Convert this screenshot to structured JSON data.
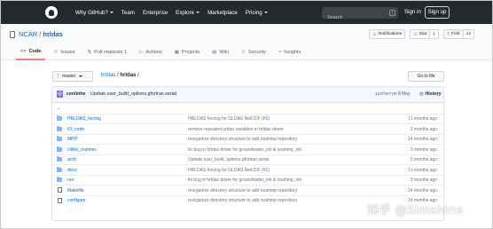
{
  "topnav": {
    "links": [
      {
        "label": "Why GitHub?",
        "dropdown": true
      },
      {
        "label": "Team",
        "dropdown": false
      },
      {
        "label": "Enterprise",
        "dropdown": false
      },
      {
        "label": "Explore",
        "dropdown": true
      },
      {
        "label": "Marketplace",
        "dropdown": false
      },
      {
        "label": "Pricing",
        "dropdown": true
      }
    ],
    "search_placeholder": "Search",
    "search_shortcut": "/",
    "signin": "Sign in",
    "signup": "Sign up"
  },
  "repo": {
    "owner": "NCAR",
    "separator": "/",
    "name": "hrldas",
    "actions": [
      {
        "icon": "bell-icon",
        "label": "Notifications",
        "count": ""
      },
      {
        "icon": "star-icon",
        "label": "Star",
        "count": "1"
      },
      {
        "icon": "fork-icon",
        "label": "Fork",
        "count": "12"
      }
    ],
    "tabs": [
      {
        "icon": "code-icon",
        "label": "Code",
        "active": true
      },
      {
        "icon": "issues-icon",
        "label": "Issues",
        "active": false
      },
      {
        "icon": "pull-request-icon",
        "label": "Pull requests",
        "count": "1",
        "active": false
      },
      {
        "icon": "actions-icon",
        "label": "Actions",
        "active": false
      },
      {
        "icon": "projects-icon",
        "label": "Projects",
        "active": false
      },
      {
        "icon": "wiki-icon",
        "label": "Wiki",
        "active": false
      },
      {
        "icon": "security-icon",
        "label": "Security",
        "active": false
      },
      {
        "icon": "insights-icon",
        "label": "Insights",
        "active": false
      }
    ]
  },
  "branch": {
    "name": "master",
    "path_root": "hrldas",
    "path_dir": "hrldas",
    "go_to_file": "Go to file"
  },
  "commit": {
    "author": "cenlinhe",
    "message": "Update user_build_options.gfortran.serial",
    "sha": "123f697",
    "date": "on 8 May",
    "history": "History"
  },
  "files": [
    {
      "type": "parent",
      "name": "..",
      "message": "",
      "issue": "",
      "age": ""
    },
    {
      "type": "dir",
      "name": "HRLDAS_forcing",
      "message": "HRLDAS forcing for GLDAS NetCDF (",
      "issue": "#1",
      "message_end": ")",
      "age": "11 months ago"
    },
    {
      "type": "dir",
      "name": "IO_code",
      "message": "remove repeated urban variables in hrldas driver",
      "issue": "",
      "message_end": "",
      "age": "3 months ago"
    },
    {
      "type": "dir",
      "name": "MPP",
      "message": "reorganize directory structure to add noahmp repository",
      "issue": "",
      "message_end": "",
      "age": "14 months ago"
    },
    {
      "type": "dir",
      "name": "Utility_routines",
      "message": "fix bug in hrldas driver for groundwater_init & noahmp_init",
      "issue": "",
      "message_end": "",
      "age": "3 months ago"
    },
    {
      "type": "dir",
      "name": "arch",
      "message": "Update user_build_options.gfortran.serial",
      "issue": "",
      "message_end": "",
      "age": "2 months ago"
    },
    {
      "type": "dir",
      "name": "docs",
      "message": "HRLDAS forcing for GLDAS NetCDF (",
      "issue": "#1",
      "message_end": ")",
      "age": "11 months ago"
    },
    {
      "type": "dir",
      "name": "run",
      "message": "fix bug in hrldas driver for groundwater_init & noahmp_init",
      "issue": "",
      "message_end": "",
      "age": "3 months ago"
    },
    {
      "type": "file",
      "name": "Makefile",
      "message": "reorganize directory structure to add noahmp repository",
      "issue": "",
      "message_end": "",
      "age": "14 months ago"
    },
    {
      "type": "file",
      "name": "configure",
      "message": "reorganize directory structure to add noahmp repository",
      "issue": "",
      "message_end": "",
      "age": "14 months ago"
    }
  ],
  "watermark": "知乎 @Simshine"
}
